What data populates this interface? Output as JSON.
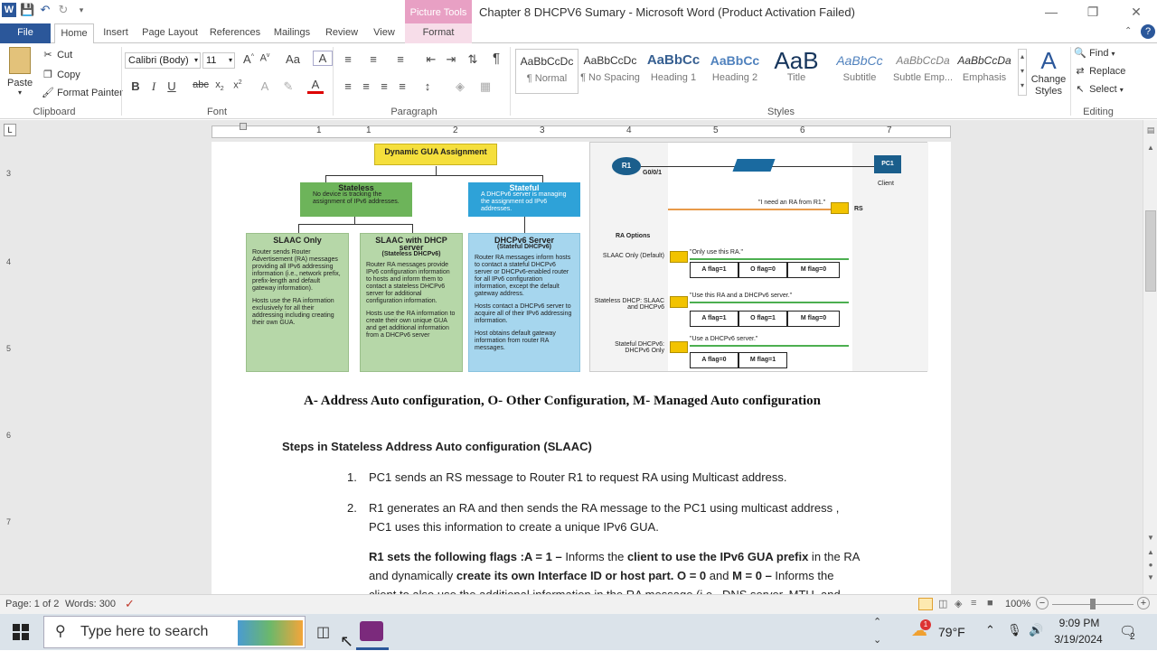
{
  "window": {
    "title": "Chapter 8 DHCPV6 Sumary - Microsoft Word (Product Activation Failed)",
    "context_tab_group": "Picture Tools",
    "qat_icons": [
      "word-app-icon",
      "save-icon",
      "undo-icon",
      "redo-icon",
      "customize-qat-icon"
    ]
  },
  "tabs": [
    "File",
    "Home",
    "Insert",
    "Page Layout",
    "References",
    "Mailings",
    "Review",
    "View",
    "Format"
  ],
  "ribbon": {
    "clipboard": {
      "paste": "Paste",
      "cut": "Cut",
      "copy": "Copy",
      "format_painter": "Format Painter",
      "label": "Clipboard"
    },
    "font": {
      "name": "Calibri (Body)",
      "size": "11",
      "label": "Font"
    },
    "paragraph": {
      "label": "Paragraph"
    },
    "styles": {
      "label": "Styles",
      "items": [
        {
          "sample": "AaBbCcDc",
          "name": "¶ Normal"
        },
        {
          "sample": "AaBbCcDc",
          "name": "¶ No Spacing"
        },
        {
          "sample": "AaBbCc",
          "name": "Heading 1"
        },
        {
          "sample": "AaBbCc",
          "name": "Heading 2"
        },
        {
          "sample": "AaB",
          "name": "Title"
        },
        {
          "sample": "AaBbCc",
          "name": "Subtitle"
        },
        {
          "sample": "AaBbCcDa",
          "name": "Subtle Emp..."
        },
        {
          "sample": "AaBbCcDa",
          "name": "Emphasis"
        }
      ],
      "change_styles": "Change Styles"
    },
    "editing": {
      "find": "Find",
      "replace": "Replace",
      "select": "Select",
      "label": "Editing"
    }
  },
  "ruler": {
    "numbers": [
      "1",
      "1",
      "2",
      "3",
      "4",
      "5",
      "6",
      "7"
    ]
  },
  "vruler": {
    "numbers": [
      "3",
      "4",
      "5",
      "6",
      "7"
    ]
  },
  "diagram_left": {
    "top": "Dynamic GUA Assignment",
    "stateless": {
      "title": "Stateless",
      "text": "No device is tracking the assignment of IPv6 addresses."
    },
    "stateful": {
      "title": "Stateful",
      "text": "A DHCPv6 server is managing the assignment od IPv6 addresses."
    },
    "slaac": {
      "title": "SLAAC Only",
      "b1": "Router sends Router Advertisement (RA) messages providing all IPv6 addressing information (i.e., network prefix, prefix-length and default gateway information).",
      "b2": "Hosts use the RA information exclusively for all their addressing including creating their own GUA."
    },
    "stateless_dhcp": {
      "title": "SLAAC with DHCP server",
      "subtitle": "(Stateless DHCPv6)",
      "b1": "Router RA messages provide IPv6 configuration information to hosts and inform them to contact a stateless DHCPv6 server for additional configuration information.",
      "b2": "Hosts use the RA information to create their own unique GUA and get additional information from a DHCPv6 server"
    },
    "dhcp_server": {
      "title": "DHCPv6 Server",
      "subtitle": "(Stateful DHCPv6)",
      "b1": "Router RA messages inform hosts to contact a stateful DHCPv6 server or DHCPv6-enabled router for all IPv6 configuration information, except the default gateway address.",
      "b2": "Hosts contact a DHCPv6 server to acquire all of their IPv6 addressing information.",
      "b3": "Host obtains default gateway information from router RA messages."
    }
  },
  "diagram_right": {
    "router": "R1",
    "iface": "G0/0/1",
    "pc": "PC1",
    "client": "Client",
    "rs_msg": "\"I need an RA from R1.\"",
    "rs": "RS",
    "ra_options": "RA Options",
    "rows": [
      {
        "label": "SLAAC Only (Default)",
        "msg": "\"Only use this RA.\"",
        "flags": [
          "A flag=1",
          "O flag=0",
          "M flag=0"
        ]
      },
      {
        "label": "Stateless DHCP: SLAAC and DHCPv6",
        "msg": "\"Use this RA and a DHCPv6 server.\"",
        "flags": [
          "A flag=1",
          "O flag=1",
          "M flag=0"
        ]
      },
      {
        "label": "Stateful DHCPv6: DHCPv6 Only",
        "msg": "\"Use a DHCPv6 server.\"",
        "flags": [
          "A flag=0",
          "M flag=1"
        ]
      }
    ]
  },
  "document": {
    "caption": "A-  Address Auto configuration, O- Other Configuration, M- Managed Auto configuration",
    "heading": "Steps in Stateless Address Auto configuration (SLAAC)",
    "item1_num": "1.",
    "item1": "PC1 sends an RS message to Router R1  to request RA using Multicast address.",
    "item2_num": "2.",
    "item2_line1": "R1 generates an RA and then sends the RA message to the PC1 using multicast address ,",
    "item2_line2": "PC1 uses this information to create a unique IPv6 GUA.",
    "para3_b1": "R1 sets the following  flags :A = 1 – ",
    "para3_t1": "Informs the ",
    "para3_b2": "client to use the IPv6 GUA prefix",
    "para3_t2": " in the RA",
    "para3_line2_t1": "and dynamically ",
    "para3_line2_b1": "create its own Interface ID or host part.  O = 0",
    "para3_line2_t2": " and ",
    "para3_line2_b2": "M = 0 –",
    "para3_line2_t3": " Informs the",
    "para3_line3": "client to also use the additional information in the RA message (i.e., DNS server, MTU, and"
  },
  "statusbar": {
    "page": "Page: 1 of 2",
    "words": "Words: 300",
    "zoom": "100%"
  },
  "taskbar": {
    "search_placeholder": "Type here to search",
    "weather": "79°F",
    "time": "9:09 PM",
    "date": "3/19/2024",
    "notif_count": "2"
  }
}
